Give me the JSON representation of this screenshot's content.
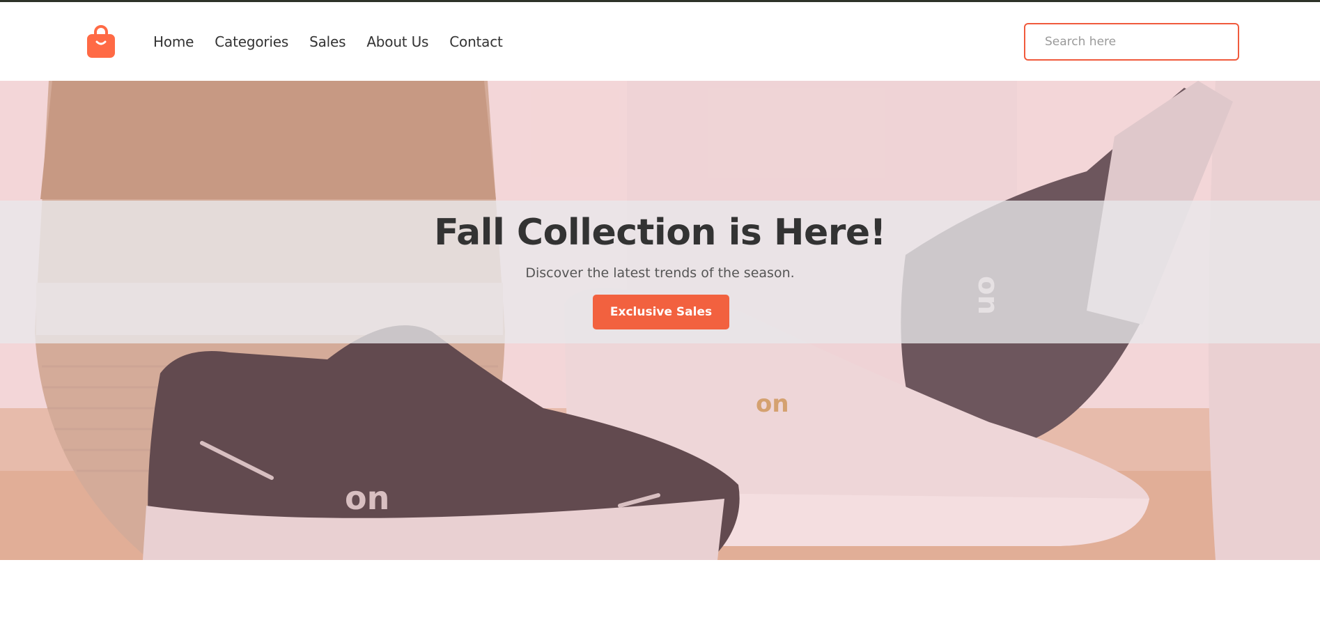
{
  "brand": {
    "logo_icon": "shopping-bag-icon",
    "accent": "#f2613f"
  },
  "nav": {
    "items": [
      {
        "label": "Home"
      },
      {
        "label": "Categories"
      },
      {
        "label": "Sales"
      },
      {
        "label": "About Us"
      },
      {
        "label": "Contact"
      }
    ]
  },
  "search": {
    "placeholder": "Search here",
    "value": ""
  },
  "hero": {
    "title": "Fall Collection is Here!",
    "subtitle": "Discover the latest trends of the season.",
    "cta_label": "Exclusive Sales",
    "image": "sneakers-photo"
  }
}
